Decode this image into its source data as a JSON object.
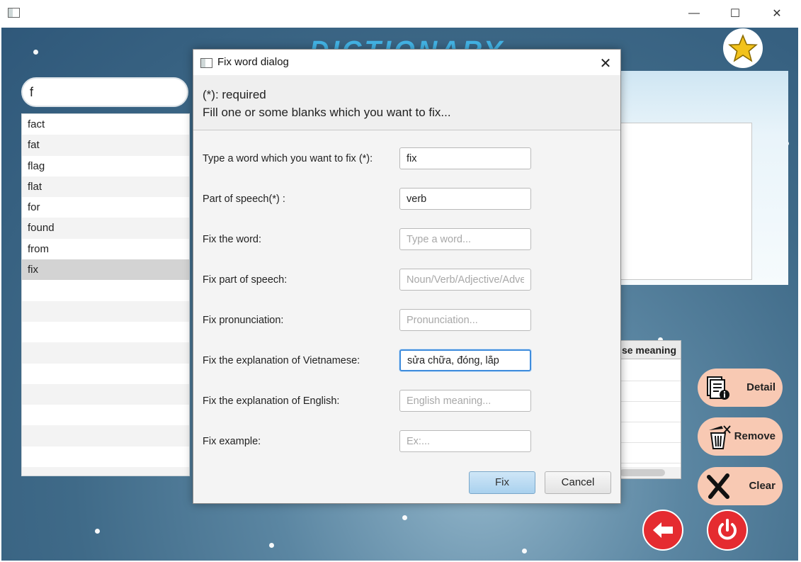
{
  "window": {
    "title_fragment": "",
    "minimize": "—",
    "maximize": "☐",
    "close": "✕"
  },
  "app": {
    "banner_title": "DICTIONARY",
    "search_value": "f",
    "words": [
      "fact",
      "fat",
      "flag",
      "flat",
      "for",
      "found",
      "from",
      "fix"
    ],
    "selected_word": "fix",
    "table_header": "se meaning",
    "buttons": {
      "detail": "Detail",
      "remove": "Remove",
      "clear": "Clear"
    },
    "icons": [
      "star-icon",
      "detail-icon",
      "trash-icon",
      "x-icon",
      "back-arrow-icon",
      "power-icon"
    ],
    "colors": {
      "pill_bg": "#f8c9b3",
      "round_btn": "#e52b30",
      "banner": "#43b5e8"
    }
  },
  "dialog": {
    "title": "Fix word dialog",
    "close": "✕",
    "header_line1": "(*): required",
    "header_line2": "Fill one or some blanks which you want to fix...",
    "fields": [
      {
        "label": "Type a word which you want to fix (*):",
        "value": "fix",
        "placeholder": ""
      },
      {
        "label": "Part of speech(*) :",
        "value": "verb",
        "placeholder": ""
      },
      {
        "label": "Fix the word:",
        "value": "",
        "placeholder": "Type a word..."
      },
      {
        "label": "Fix part of speech:",
        "value": "",
        "placeholder": "Noun/Verb/Adjective/Adverb"
      },
      {
        "label": "Fix pronunciation:",
        "value": "",
        "placeholder": "Pronunciation..."
      },
      {
        "label": "Fix the explanation of Vietnamese:",
        "value": "sửa chữa, đóng, lắp",
        "placeholder": ""
      },
      {
        "label": "Fix the explanation of English:",
        "value": "",
        "placeholder": "English meaning..."
      },
      {
        "label": "Fix example:",
        "value": "",
        "placeholder": "Ex:..."
      }
    ],
    "fix_button": "Fix",
    "cancel_button": "Cancel",
    "focus_color": "#3f8cdc"
  }
}
